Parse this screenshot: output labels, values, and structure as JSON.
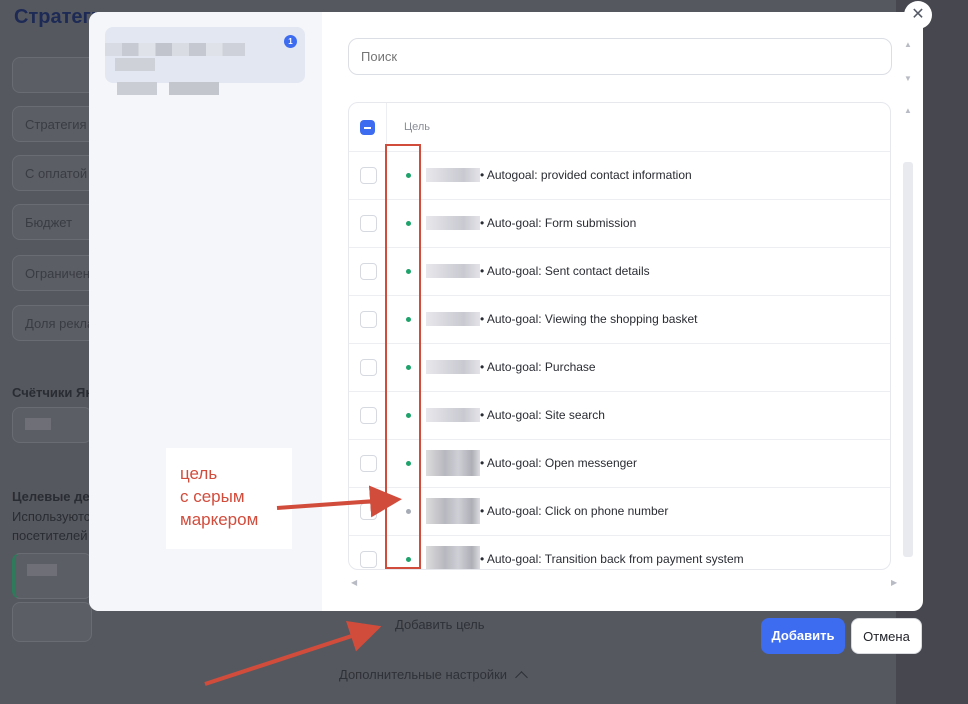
{
  "background": {
    "title": "Стратегия",
    "fields": [
      "",
      "Стратегия",
      "С оплатой",
      "Бюджет",
      "Ограничение",
      "Доля рекламы"
    ],
    "counters_label": "Счётчики Яндекс",
    "goals_label": "Целевые действия",
    "goals_desc_1": "Используются",
    "goals_desc_2": "посетителей",
    "add_goal_label": "Добавить цель",
    "advanced_label": "Дополнительные настройки"
  },
  "modal": {
    "counter_badge": "1",
    "search_placeholder": "Поиск",
    "column_header": "Цель",
    "goals": [
      {
        "label": "• Autogoal: provided contact information",
        "marker": "green"
      },
      {
        "label": "• Auto-goal: Form submission",
        "marker": "green"
      },
      {
        "label": "• Auto-goal: Sent contact details",
        "marker": "green"
      },
      {
        "label": "• Auto-goal: Viewing the shopping basket",
        "marker": "green"
      },
      {
        "label": "• Auto-goal: Purchase",
        "marker": "green"
      },
      {
        "label": "• Auto-goal: Site search",
        "marker": "green"
      },
      {
        "label": "• Auto-goal: Open messenger",
        "marker": "green"
      },
      {
        "label": "• Auto-goal: Click on phone number",
        "marker": "gray"
      },
      {
        "label": "• Auto-goal: Transition back from payment system",
        "marker": "green"
      }
    ],
    "close_icon": "✕"
  },
  "footer": {
    "add_button": "Добавить",
    "cancel_button": "Отмена"
  },
  "annotation": {
    "line1": "цель",
    "line2": "с серым",
    "line3": "маркером"
  },
  "colors": {
    "accent": "#3d6cf0",
    "marker_green": "#1ea36b",
    "marker_gray": "#a6abb6",
    "annotation_red": "#d24c3c"
  }
}
